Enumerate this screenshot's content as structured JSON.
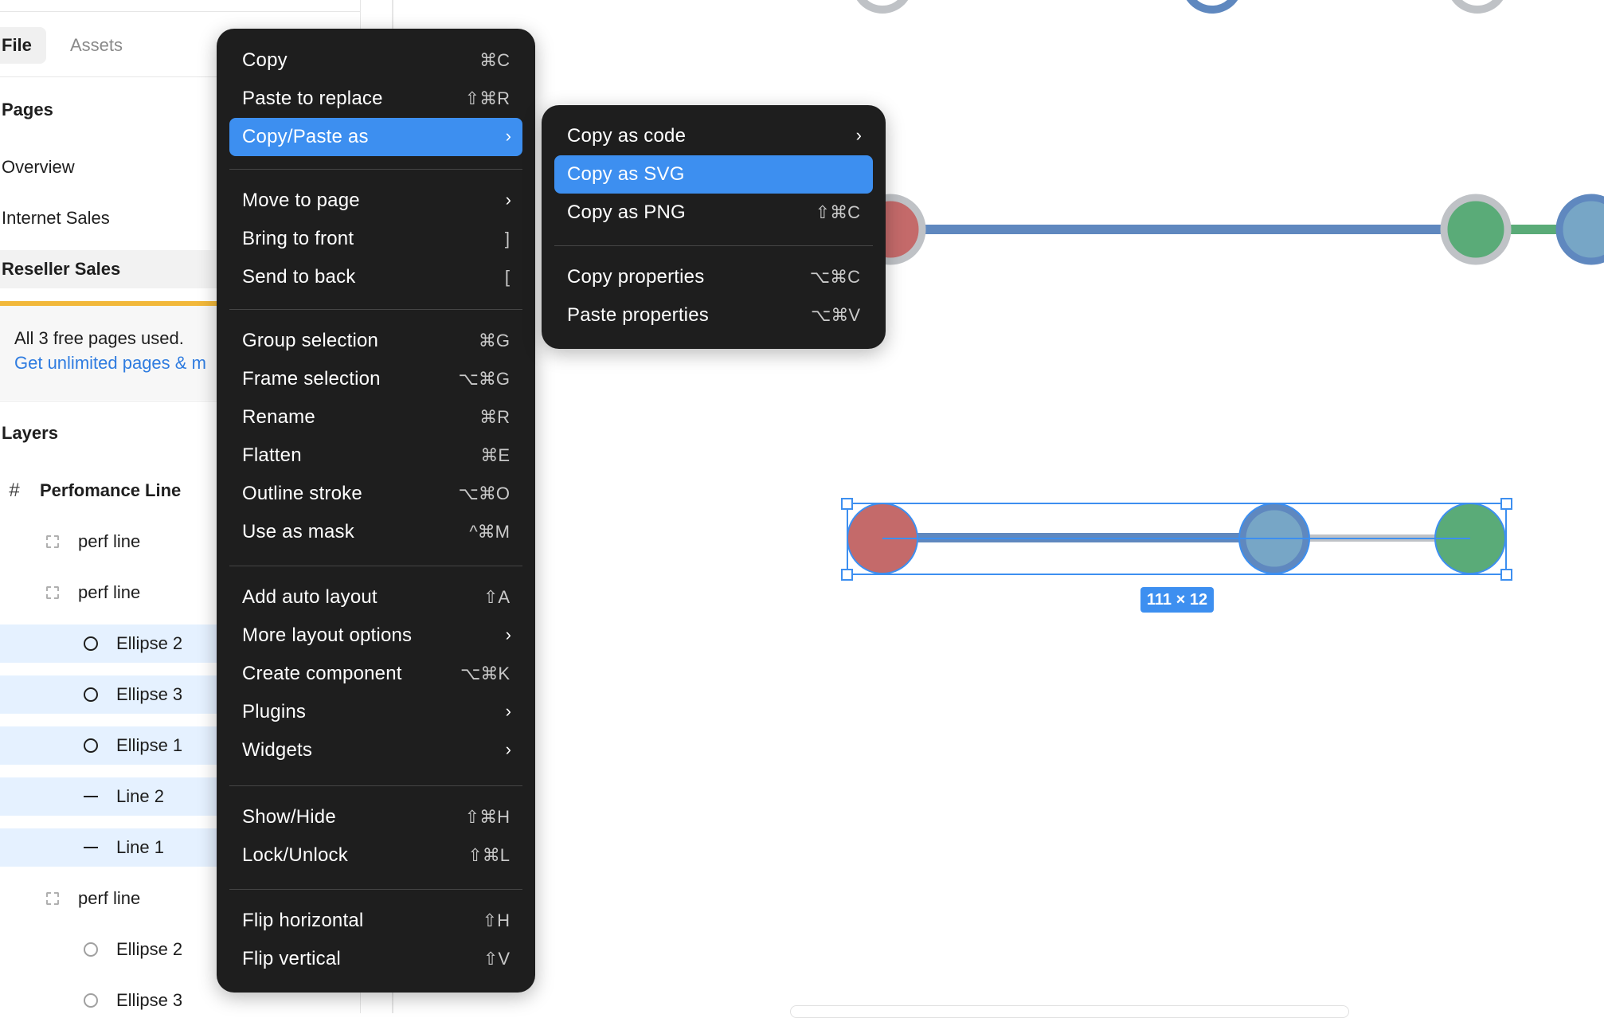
{
  "sidebar": {
    "tabs": {
      "file": "File",
      "assets": "Assets"
    },
    "pages_title": "Pages",
    "pages": [
      "Overview",
      "Internet Sales",
      "Reseller Sales"
    ],
    "notice": {
      "text": "All 3 free pages used.",
      "link": "Get unlimited pages & m"
    },
    "layers_title": "Layers",
    "layers": {
      "frame": "Perfomance Line",
      "perf1": "perf line",
      "perf2": "perf line",
      "ellipse2": "Ellipse 2",
      "ellipse3": "Ellipse 3",
      "ellipse1": "Ellipse 1",
      "line2": "Line 2",
      "line1": "Line 1",
      "perf3": "perf line",
      "ellipse2b": "Ellipse 2",
      "ellipse3b": "Ellipse 3"
    }
  },
  "context_menu": {
    "copy": {
      "label": "Copy",
      "shortcut": "⌘C"
    },
    "paste_replace": {
      "label": "Paste to replace",
      "shortcut": "⇧⌘R"
    },
    "copy_paste_as": {
      "label": "Copy/Paste as"
    },
    "move_to_page": {
      "label": "Move to page"
    },
    "bring_front": {
      "label": "Bring to front",
      "shortcut": "]"
    },
    "send_back": {
      "label": "Send to back",
      "shortcut": "["
    },
    "group": {
      "label": "Group selection",
      "shortcut": "⌘G"
    },
    "frame": {
      "label": "Frame selection",
      "shortcut": "⌥⌘G"
    },
    "rename": {
      "label": "Rename",
      "shortcut": "⌘R"
    },
    "flatten": {
      "label": "Flatten",
      "shortcut": "⌘E"
    },
    "outline": {
      "label": "Outline stroke",
      "shortcut": "⌥⌘O"
    },
    "mask": {
      "label": "Use as mask",
      "shortcut": "^⌘M"
    },
    "auto_layout": {
      "label": "Add auto layout",
      "shortcut": "⇧A"
    },
    "more_layout": {
      "label": "More layout options"
    },
    "component": {
      "label": "Create component",
      "shortcut": "⌥⌘K"
    },
    "plugins": {
      "label": "Plugins"
    },
    "widgets": {
      "label": "Widgets"
    },
    "show_hide": {
      "label": "Show/Hide",
      "shortcut": "⇧⌘H"
    },
    "lock": {
      "label": "Lock/Unlock",
      "shortcut": "⇧⌘L"
    },
    "flip_h": {
      "label": "Flip horizontal",
      "shortcut": "⇧H"
    },
    "flip_v": {
      "label": "Flip vertical",
      "shortcut": "⇧V"
    }
  },
  "submenu": {
    "copy_code": {
      "label": "Copy as code"
    },
    "copy_svg": {
      "label": "Copy as SVG"
    },
    "copy_png": {
      "label": "Copy as PNG",
      "shortcut": "⇧⌘C"
    },
    "copy_props": {
      "label": "Copy properties",
      "shortcut": "⌥⌘C"
    },
    "paste_props": {
      "label": "Paste properties",
      "shortcut": "⌥⌘V"
    }
  },
  "canvas": {
    "selection_size": "111 × 12",
    "colors": {
      "blue_line": "#5f88bf",
      "red_dot": "#c46a6a",
      "green_dot": "#5aab78",
      "light_blue_dot": "#77a6c6",
      "gray_ring": "#bfc2c6",
      "selection": "#3d8ff0"
    }
  },
  "icons": {
    "frame": "frame-hash-icon",
    "group": "dashed-group-icon",
    "ellipse": "ellipse-icon",
    "line": "line-icon",
    "submenu_arrow": "chevron-right-icon"
  }
}
